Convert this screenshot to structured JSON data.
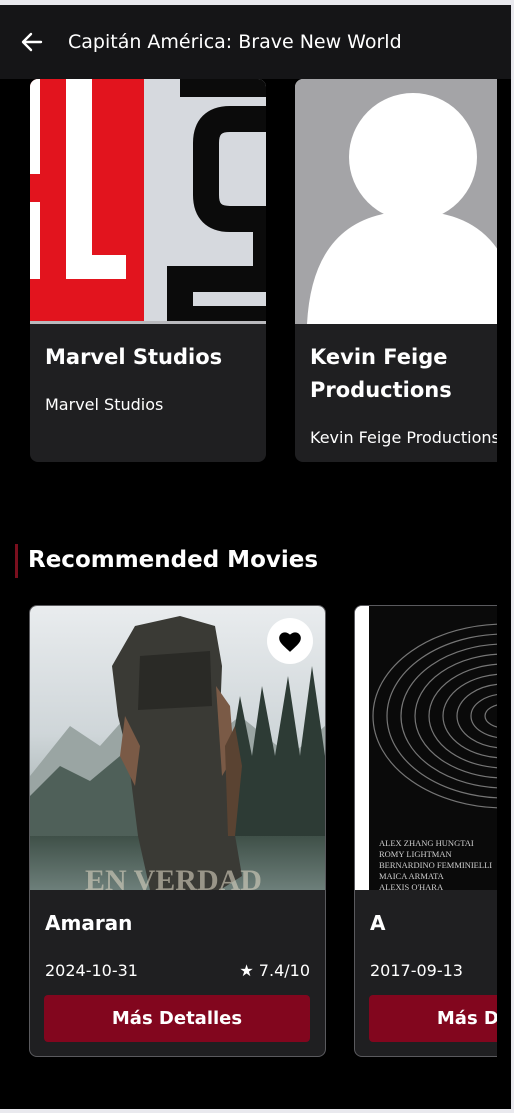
{
  "appbar": {
    "back_icon": "arrow-left-icon",
    "title": "Capitán América: Brave New World"
  },
  "companies": [
    {
      "name": "Marvel Studios",
      "subtitle": "Marvel Studios",
      "logo_text": "EL S"
    },
    {
      "name": "Kevin Feige Productions",
      "subtitle": "Kevin Feige Productions",
      "image": "person-placeholder-icon"
    }
  ],
  "recommended": {
    "title": "Recommended Movies",
    "accent_color": "#7a0f1e",
    "movies": [
      {
        "title": "Amaran",
        "date": "2024-10-31",
        "rating": "★ 7.4/10",
        "button": "Más Detalles",
        "favorite_icon": "heart-icon",
        "poster_caption": "EN VERDAD"
      },
      {
        "title": "A",
        "date": "2017-09-13",
        "button": "Más Detalles",
        "poster_credits": [
          "ALEX ZHANG HUNGTAI",
          "ROMY LIGHTMAN",
          "BERNARDINO FEMMINIELLI",
          "MAICA ARMATA",
          "ALEXIS O'HARA"
        ]
      }
    ]
  },
  "colors": {
    "button_bg": "#82061e",
    "card_bg": "#1f1f21",
    "appbar_bg": "#151517"
  }
}
